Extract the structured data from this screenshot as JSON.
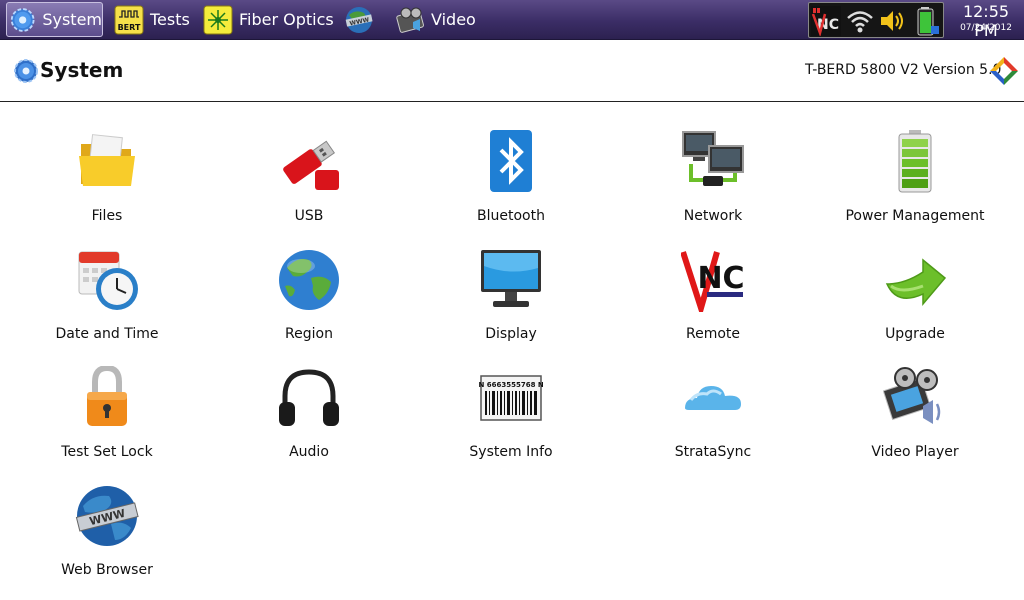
{
  "taskbar": {
    "tabs": [
      {
        "label": "System",
        "icon": "gear-icon",
        "active": true
      },
      {
        "label": "Tests",
        "icon": "bert-icon",
        "active": false
      },
      {
        "label": "Fiber Optics",
        "icon": "fiber-optics-icon",
        "active": false
      },
      {
        "label": "",
        "icon": "www-globe-icon",
        "active": false
      },
      {
        "label": "Video",
        "icon": "video-icon",
        "active": false
      }
    ],
    "bert_badge": "BERT",
    "tray_icons": [
      "remote-vnc-icon",
      "wifi-icon",
      "speaker-icon",
      "battery-icon"
    ],
    "vnc_text": "NC",
    "clock": {
      "time": "12:55 PM",
      "date": "07/24/2012"
    }
  },
  "header": {
    "title": "System",
    "version": "T-BERD 5800 V2 Version 5.0"
  },
  "apps": [
    {
      "label": "Files",
      "icon": "folder-icon"
    },
    {
      "label": "USB",
      "icon": "usb-icon"
    },
    {
      "label": "Bluetooth",
      "icon": "bluetooth-icon"
    },
    {
      "label": "Network",
      "icon": "network-icon"
    },
    {
      "label": "Power Management",
      "icon": "battery-icon"
    },
    {
      "label": "Date and Time",
      "icon": "calendar-clock-icon"
    },
    {
      "label": "Region",
      "icon": "globe-icon"
    },
    {
      "label": "Display",
      "icon": "monitor-icon"
    },
    {
      "label": "Remote",
      "icon": "vnc-icon"
    },
    {
      "label": "Upgrade",
      "icon": "upgrade-arrow-icon"
    },
    {
      "label": "Test Set Lock",
      "icon": "lock-icon"
    },
    {
      "label": "Audio",
      "icon": "headphones-icon"
    },
    {
      "label": "System Info",
      "icon": "barcode-icon"
    },
    {
      "label": "StrataSync",
      "icon": "cloud-icon"
    },
    {
      "label": "Video Player",
      "icon": "film-reel-icon"
    },
    {
      "label": "Web Browser",
      "icon": "www-globe-icon"
    }
  ],
  "system_info_barcode_text": "SN 6663555768 NT",
  "colors": {
    "taskbar": "#3b2d66",
    "accent_green": "#6cbf2a",
    "usb_red": "#d9141b"
  }
}
